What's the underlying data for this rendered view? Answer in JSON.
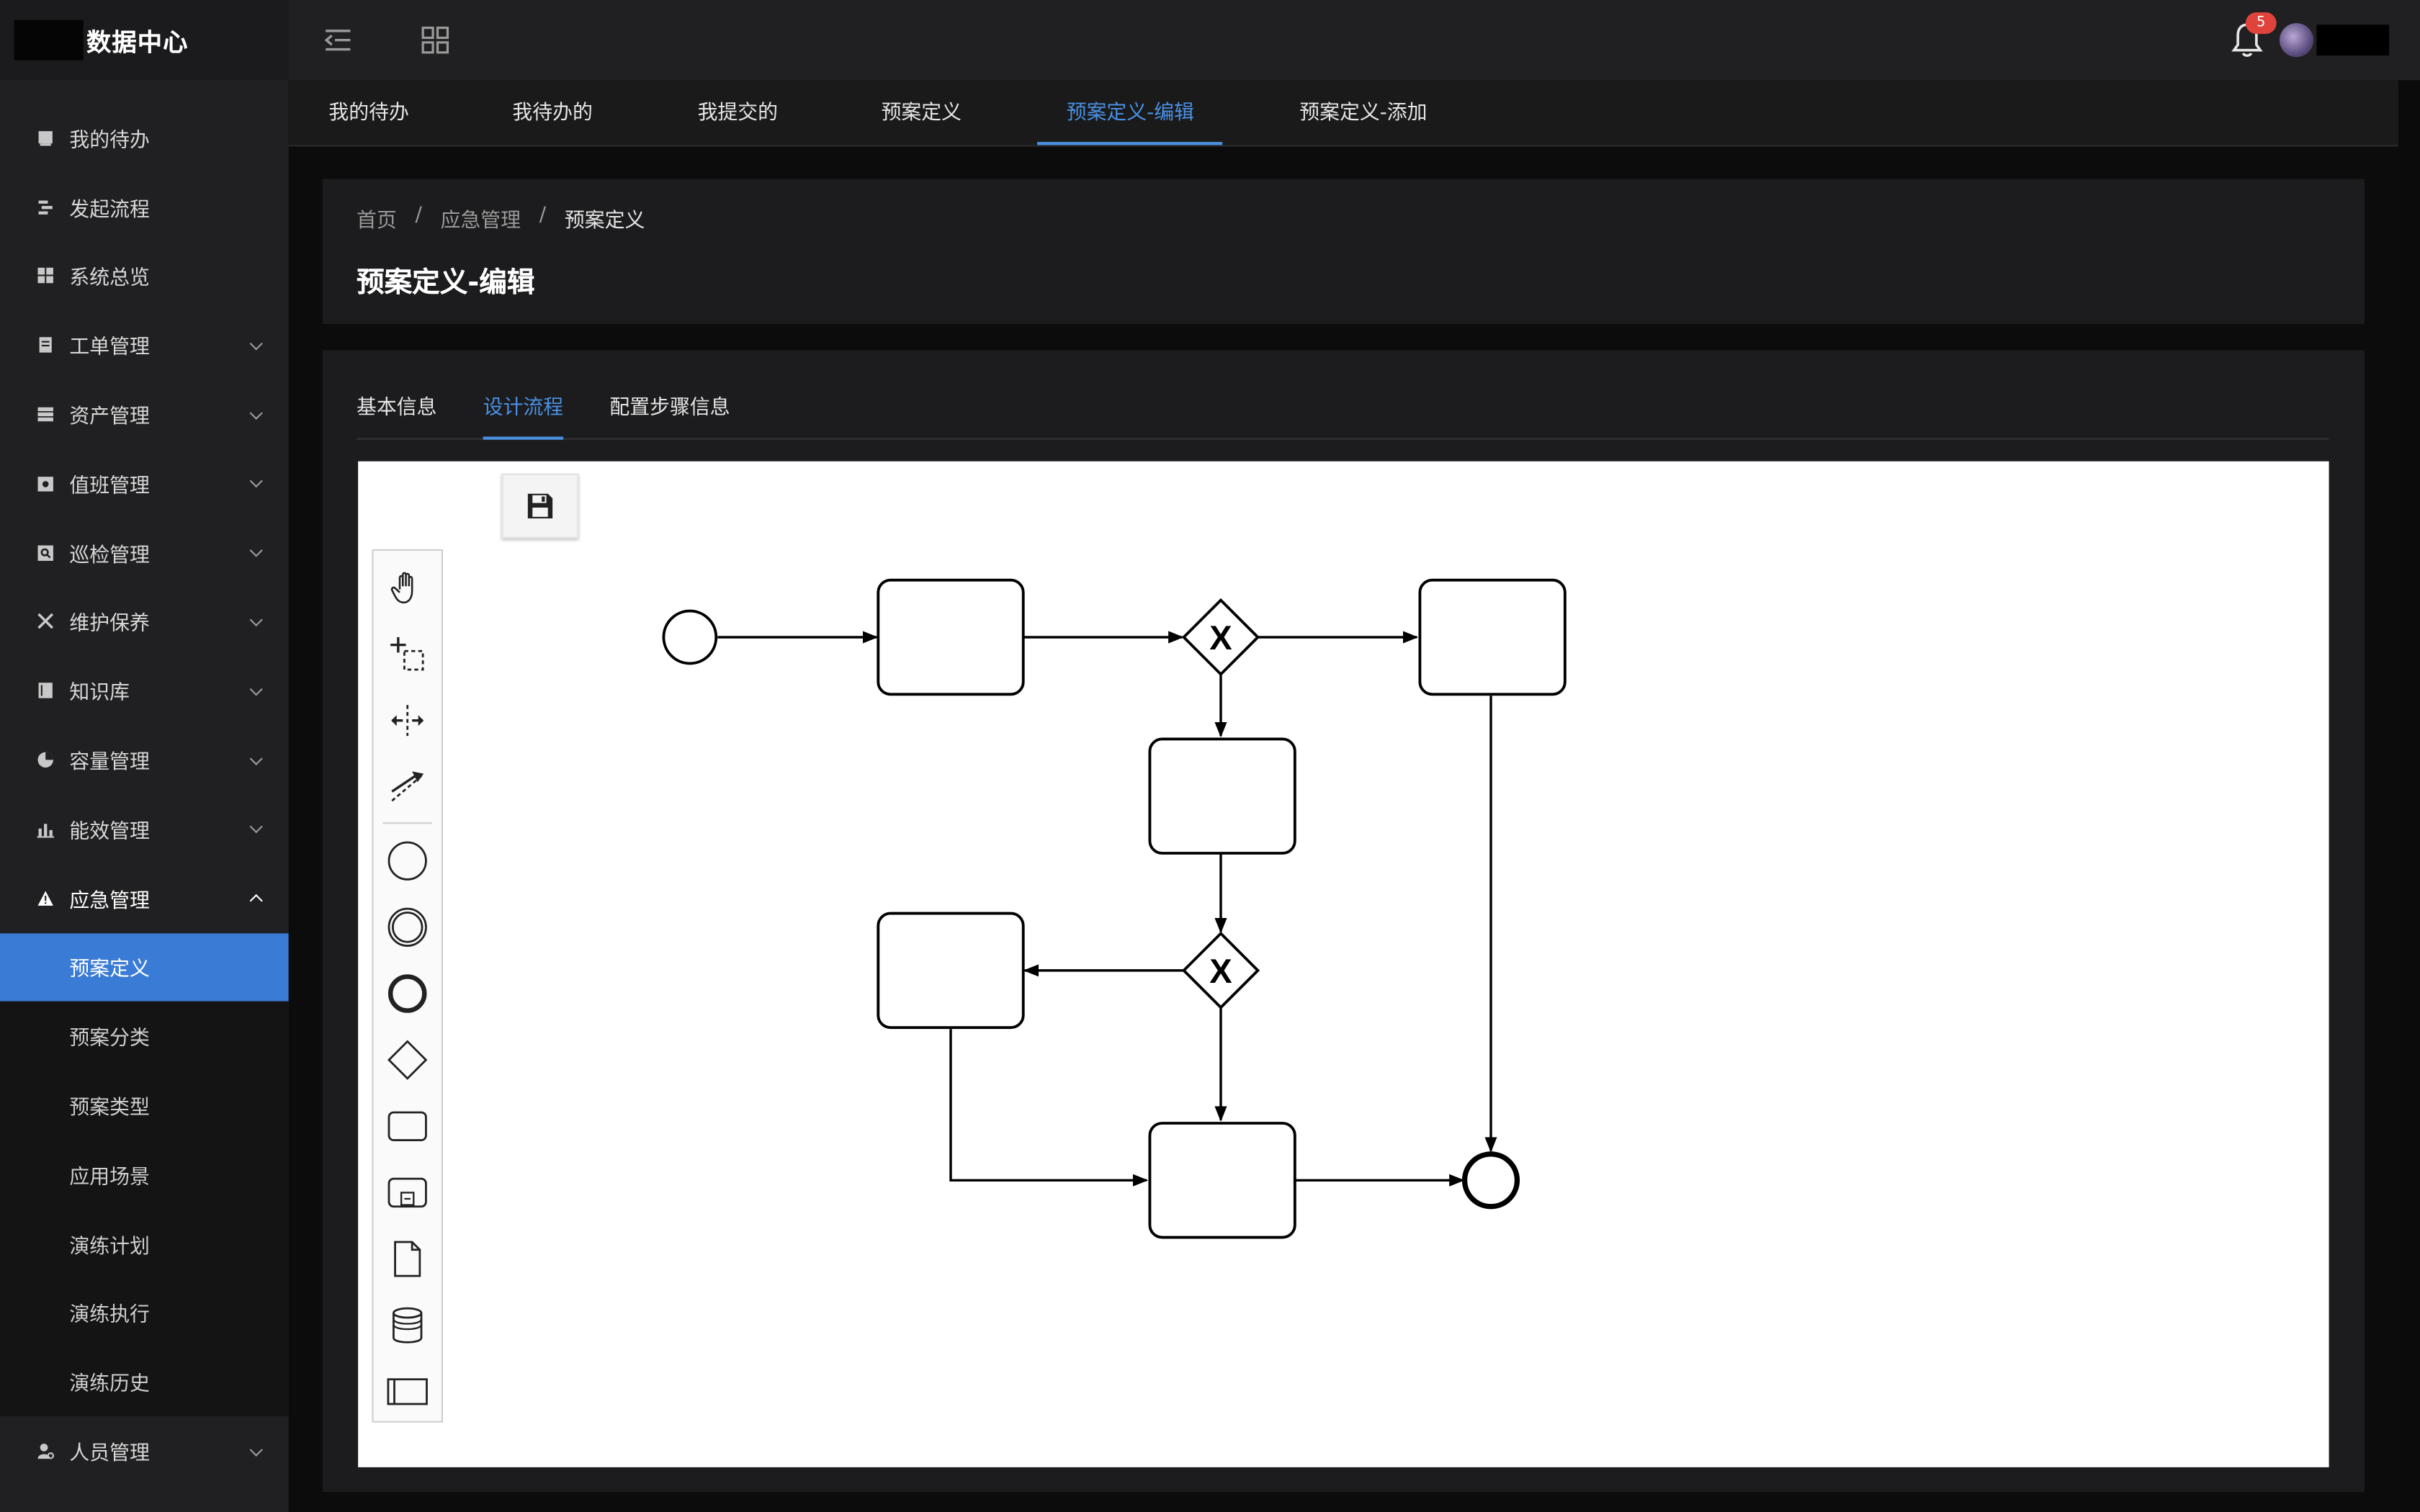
{
  "app": {
    "title": "数据中心"
  },
  "topbar": {
    "notification_count": "5"
  },
  "sidebar": {
    "items": [
      {
        "label": "我的待办",
        "icon": "book-icon"
      },
      {
        "label": "发起流程",
        "icon": "flow-icon"
      },
      {
        "label": "系统总览",
        "icon": "grid-icon"
      },
      {
        "label": "工单管理",
        "icon": "document-icon"
      },
      {
        "label": "资产管理",
        "icon": "database-icon"
      },
      {
        "label": "值班管理",
        "icon": "calendar-icon"
      },
      {
        "label": "巡检管理",
        "icon": "inspect-icon"
      },
      {
        "label": "维护保养",
        "icon": "tools-icon"
      },
      {
        "label": "知识库",
        "icon": "library-icon"
      },
      {
        "label": "容量管理",
        "icon": "pie-chart-icon"
      },
      {
        "label": "能效管理",
        "icon": "bar-chart-icon"
      },
      {
        "label": "应急管理",
        "icon": "warning-icon"
      }
    ],
    "sub_items": [
      "预案定义",
      "预案分类",
      "预案类型",
      "应用场景",
      "演练计划",
      "演练执行",
      "演练历史"
    ],
    "bottom_items": [
      {
        "label": "人员管理",
        "icon": "user-icon"
      }
    ]
  },
  "tabs": [
    "我的待办",
    "我待办的",
    "我提交的",
    "预案定义",
    "预案定义-编辑",
    "预案定义-添加"
  ],
  "breadcrumb": {
    "home": "首页",
    "parent": "应急管理",
    "current": "预案定义",
    "sep": "/"
  },
  "page_title": "预案定义-编辑",
  "content_tabs": [
    "基本信息",
    "设计流程",
    "配置步骤信息"
  ],
  "diagram": {
    "palette_tools": [
      "hand-tool",
      "lasso-tool",
      "space-tool",
      "connect-tool",
      "start-event",
      "intermediate-event",
      "end-event",
      "gateway",
      "task",
      "subprocess",
      "data-object",
      "data-store",
      "pool"
    ],
    "gateway_marker": "X",
    "nodes": {
      "start_event": 1,
      "tasks": 5,
      "exclusive_gateways": 2,
      "end_event": 1
    }
  }
}
